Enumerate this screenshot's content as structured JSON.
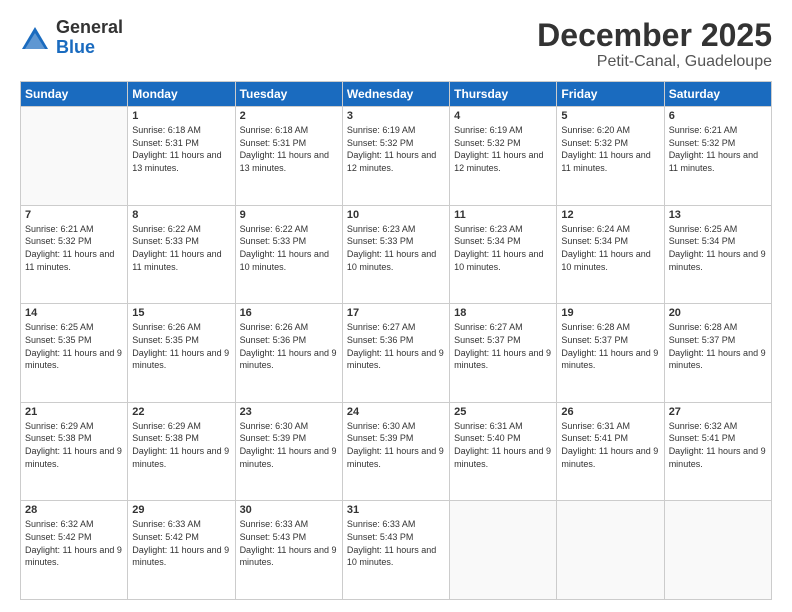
{
  "logo": {
    "general": "General",
    "blue": "Blue"
  },
  "header": {
    "month": "December 2025",
    "location": "Petit-Canal, Guadeloupe"
  },
  "weekdays": [
    "Sunday",
    "Monday",
    "Tuesday",
    "Wednesday",
    "Thursday",
    "Friday",
    "Saturday"
  ],
  "weeks": [
    [
      {
        "day": "",
        "sunrise": "",
        "sunset": "",
        "daylight": ""
      },
      {
        "day": "1",
        "sunrise": "Sunrise: 6:18 AM",
        "sunset": "Sunset: 5:31 PM",
        "daylight": "Daylight: 11 hours and 13 minutes."
      },
      {
        "day": "2",
        "sunrise": "Sunrise: 6:18 AM",
        "sunset": "Sunset: 5:31 PM",
        "daylight": "Daylight: 11 hours and 13 minutes."
      },
      {
        "day": "3",
        "sunrise": "Sunrise: 6:19 AM",
        "sunset": "Sunset: 5:32 PM",
        "daylight": "Daylight: 11 hours and 12 minutes."
      },
      {
        "day": "4",
        "sunrise": "Sunrise: 6:19 AM",
        "sunset": "Sunset: 5:32 PM",
        "daylight": "Daylight: 11 hours and 12 minutes."
      },
      {
        "day": "5",
        "sunrise": "Sunrise: 6:20 AM",
        "sunset": "Sunset: 5:32 PM",
        "daylight": "Daylight: 11 hours and 11 minutes."
      },
      {
        "day": "6",
        "sunrise": "Sunrise: 6:21 AM",
        "sunset": "Sunset: 5:32 PM",
        "daylight": "Daylight: 11 hours and 11 minutes."
      }
    ],
    [
      {
        "day": "7",
        "sunrise": "Sunrise: 6:21 AM",
        "sunset": "Sunset: 5:32 PM",
        "daylight": "Daylight: 11 hours and 11 minutes."
      },
      {
        "day": "8",
        "sunrise": "Sunrise: 6:22 AM",
        "sunset": "Sunset: 5:33 PM",
        "daylight": "Daylight: 11 hours and 11 minutes."
      },
      {
        "day": "9",
        "sunrise": "Sunrise: 6:22 AM",
        "sunset": "Sunset: 5:33 PM",
        "daylight": "Daylight: 11 hours and 10 minutes."
      },
      {
        "day": "10",
        "sunrise": "Sunrise: 6:23 AM",
        "sunset": "Sunset: 5:33 PM",
        "daylight": "Daylight: 11 hours and 10 minutes."
      },
      {
        "day": "11",
        "sunrise": "Sunrise: 6:23 AM",
        "sunset": "Sunset: 5:34 PM",
        "daylight": "Daylight: 11 hours and 10 minutes."
      },
      {
        "day": "12",
        "sunrise": "Sunrise: 6:24 AM",
        "sunset": "Sunset: 5:34 PM",
        "daylight": "Daylight: 11 hours and 10 minutes."
      },
      {
        "day": "13",
        "sunrise": "Sunrise: 6:25 AM",
        "sunset": "Sunset: 5:34 PM",
        "daylight": "Daylight: 11 hours and 9 minutes."
      }
    ],
    [
      {
        "day": "14",
        "sunrise": "Sunrise: 6:25 AM",
        "sunset": "Sunset: 5:35 PM",
        "daylight": "Daylight: 11 hours and 9 minutes."
      },
      {
        "day": "15",
        "sunrise": "Sunrise: 6:26 AM",
        "sunset": "Sunset: 5:35 PM",
        "daylight": "Daylight: 11 hours and 9 minutes."
      },
      {
        "day": "16",
        "sunrise": "Sunrise: 6:26 AM",
        "sunset": "Sunset: 5:36 PM",
        "daylight": "Daylight: 11 hours and 9 minutes."
      },
      {
        "day": "17",
        "sunrise": "Sunrise: 6:27 AM",
        "sunset": "Sunset: 5:36 PM",
        "daylight": "Daylight: 11 hours and 9 minutes."
      },
      {
        "day": "18",
        "sunrise": "Sunrise: 6:27 AM",
        "sunset": "Sunset: 5:37 PM",
        "daylight": "Daylight: 11 hours and 9 minutes."
      },
      {
        "day": "19",
        "sunrise": "Sunrise: 6:28 AM",
        "sunset": "Sunset: 5:37 PM",
        "daylight": "Daylight: 11 hours and 9 minutes."
      },
      {
        "day": "20",
        "sunrise": "Sunrise: 6:28 AM",
        "sunset": "Sunset: 5:37 PM",
        "daylight": "Daylight: 11 hours and 9 minutes."
      }
    ],
    [
      {
        "day": "21",
        "sunrise": "Sunrise: 6:29 AM",
        "sunset": "Sunset: 5:38 PM",
        "daylight": "Daylight: 11 hours and 9 minutes."
      },
      {
        "day": "22",
        "sunrise": "Sunrise: 6:29 AM",
        "sunset": "Sunset: 5:38 PM",
        "daylight": "Daylight: 11 hours and 9 minutes."
      },
      {
        "day": "23",
        "sunrise": "Sunrise: 6:30 AM",
        "sunset": "Sunset: 5:39 PM",
        "daylight": "Daylight: 11 hours and 9 minutes."
      },
      {
        "day": "24",
        "sunrise": "Sunrise: 6:30 AM",
        "sunset": "Sunset: 5:39 PM",
        "daylight": "Daylight: 11 hours and 9 minutes."
      },
      {
        "day": "25",
        "sunrise": "Sunrise: 6:31 AM",
        "sunset": "Sunset: 5:40 PM",
        "daylight": "Daylight: 11 hours and 9 minutes."
      },
      {
        "day": "26",
        "sunrise": "Sunrise: 6:31 AM",
        "sunset": "Sunset: 5:41 PM",
        "daylight": "Daylight: 11 hours and 9 minutes."
      },
      {
        "day": "27",
        "sunrise": "Sunrise: 6:32 AM",
        "sunset": "Sunset: 5:41 PM",
        "daylight": "Daylight: 11 hours and 9 minutes."
      }
    ],
    [
      {
        "day": "28",
        "sunrise": "Sunrise: 6:32 AM",
        "sunset": "Sunset: 5:42 PM",
        "daylight": "Daylight: 11 hours and 9 minutes."
      },
      {
        "day": "29",
        "sunrise": "Sunrise: 6:33 AM",
        "sunset": "Sunset: 5:42 PM",
        "daylight": "Daylight: 11 hours and 9 minutes."
      },
      {
        "day": "30",
        "sunrise": "Sunrise: 6:33 AM",
        "sunset": "Sunset: 5:43 PM",
        "daylight": "Daylight: 11 hours and 9 minutes."
      },
      {
        "day": "31",
        "sunrise": "Sunrise: 6:33 AM",
        "sunset": "Sunset: 5:43 PM",
        "daylight": "Daylight: 11 hours and 10 minutes."
      },
      {
        "day": "",
        "sunrise": "",
        "sunset": "",
        "daylight": ""
      },
      {
        "day": "",
        "sunrise": "",
        "sunset": "",
        "daylight": ""
      },
      {
        "day": "",
        "sunrise": "",
        "sunset": "",
        "daylight": ""
      }
    ]
  ]
}
